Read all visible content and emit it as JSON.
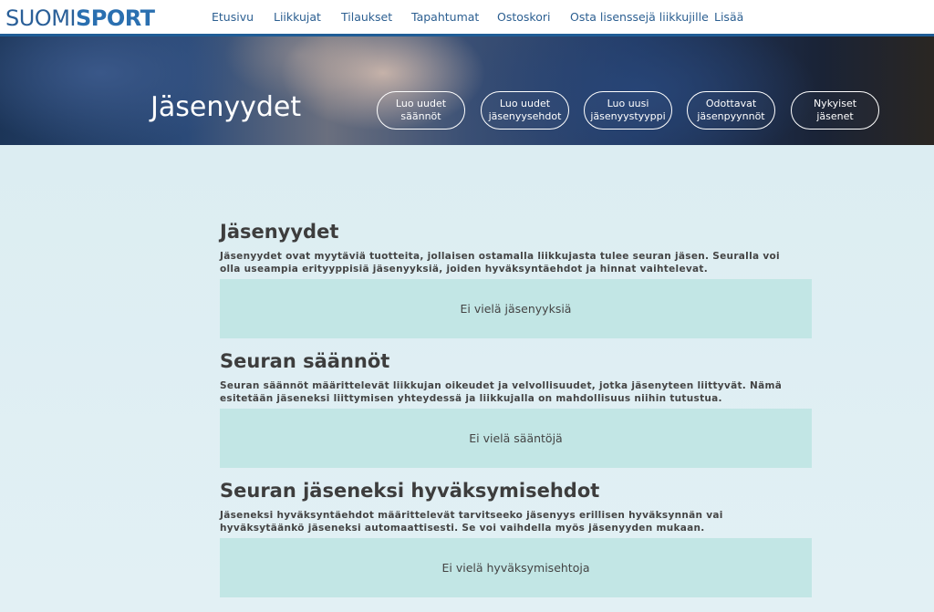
{
  "header": {
    "logo": {
      "light": "SUOMI",
      "bold": "SPORT"
    },
    "nav": [
      "Etusivu",
      "Liikkujat",
      "Tilaukset",
      "Tapahtumat",
      "Ostoskori",
      "Osta lisenssejä liikkujille",
      "Lisää"
    ]
  },
  "hero": {
    "title": "Jäsenyydet",
    "buttons": [
      "Luo uudet säännöt",
      "Luo uudet jäsenyysehdot",
      "Luo uusi jäsenyystyyppi",
      "Odottavat jäsenpyynnöt",
      "Nykyiset jäsenet"
    ]
  },
  "sections": [
    {
      "title": "Jäsenyydet",
      "description": "Jäsenyydet ovat myytäviä tuotteita, jollaisen ostamalla liikkujasta tulee seuran jäsen. Seuralla voi olla useampia erityyppisiä jäsenyyksiä, joiden hyväksyntäehdot ja hinnat vaihtelevat.",
      "empty": "Ei vielä jäsenyyksiä"
    },
    {
      "title": "Seuran säännöt",
      "description": "Seuran säännöt määrittelevät liikkujan oikeudet ja velvollisuudet, jotka jäsenyteen liittyvät. Nämä esitetään jäseneksi liittymisen yhteydessä ja liikkujalla on mahdollisuus niihin tutustua.",
      "empty": "Ei vielä sääntöjä"
    },
    {
      "title": "Seuran jäseneksi hyväksymisehdot",
      "description": "Jäseneksi hyväksyntäehdot määrittelevät tarvitseeko jäsenyys erillisen hyväksynnän vai hyväksytäänkö jäseneksi automaattisesti. Se voi vaihdella myös jäsenyyden mukaan.",
      "empty": "Ei vielä hyväksymisehtoja"
    }
  ],
  "colors": {
    "brand": "#2a6fb0",
    "nav_text": "#2c5f91",
    "content_bg": "#dcedf2",
    "empty_box": "#c2e6e5"
  }
}
